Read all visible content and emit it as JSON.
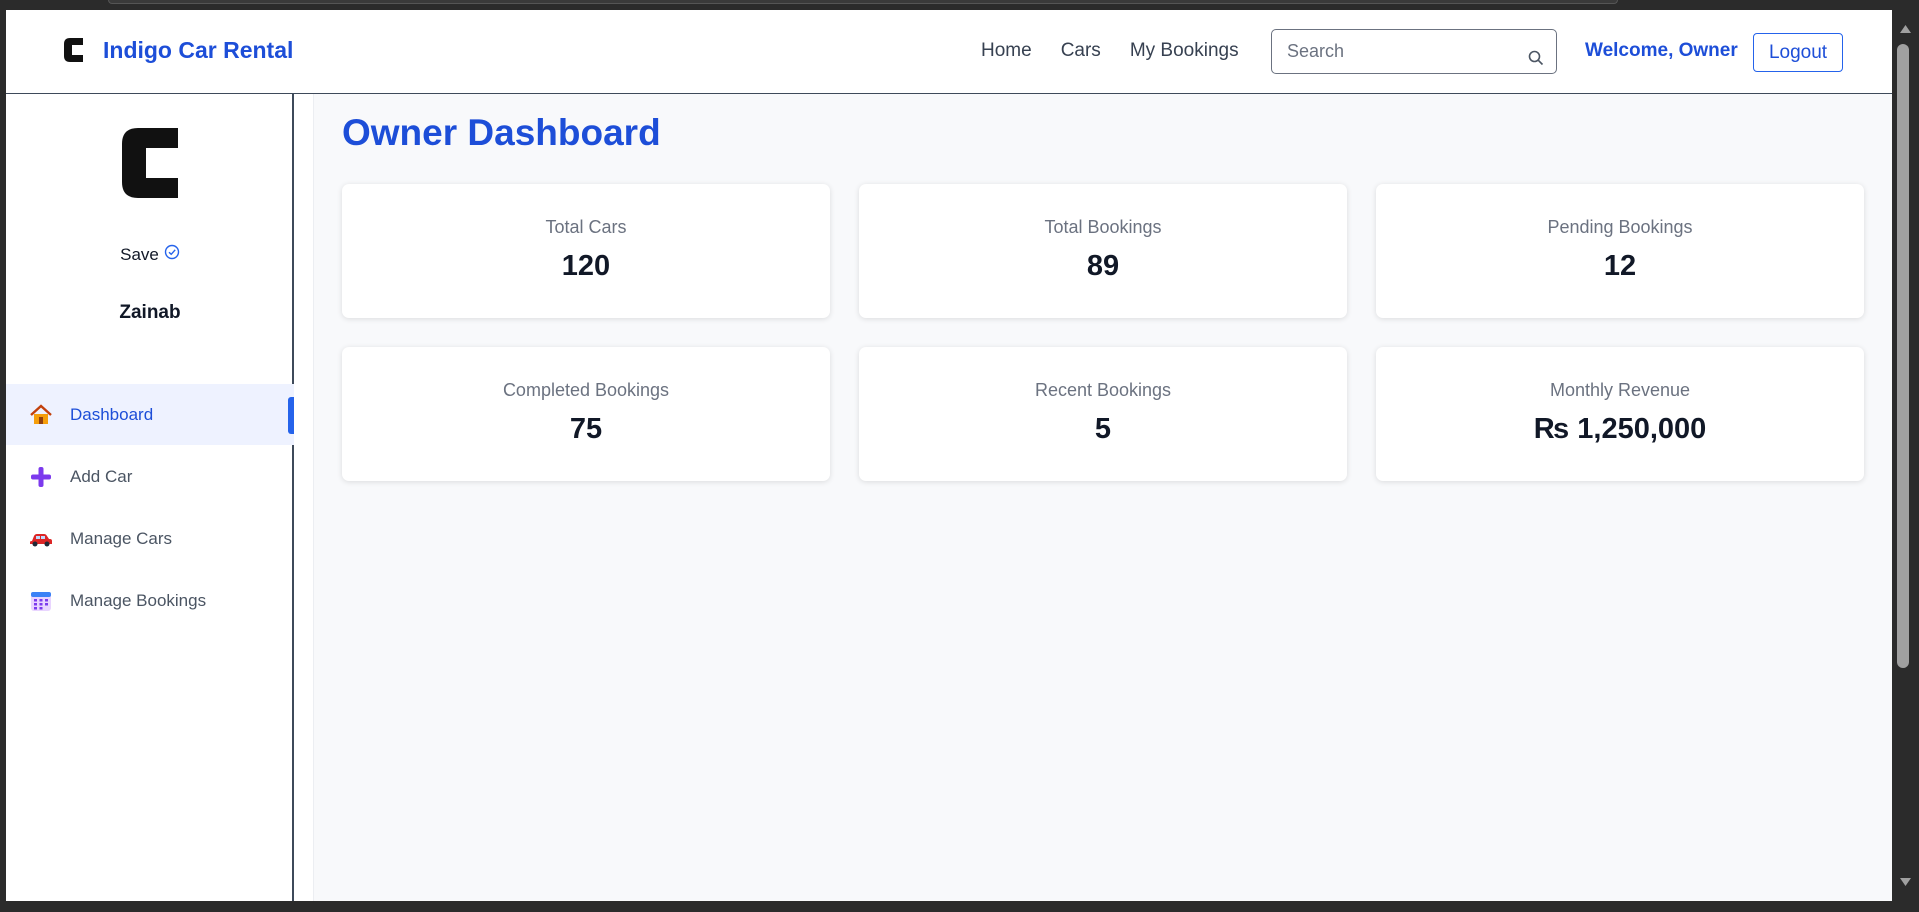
{
  "header": {
    "brand_title": "Indigo Car Rental",
    "nav": [
      "Home",
      "Cars",
      "My Bookings"
    ],
    "search_placeholder": "Search",
    "welcome": "Welcome, Owner",
    "logout_label": "Logout"
  },
  "sidebar": {
    "save_label": "Save",
    "username": "Zainab",
    "items": [
      {
        "label": "Dashboard",
        "icon": "house-icon",
        "active": true
      },
      {
        "label": "Add Car",
        "icon": "plus-icon",
        "active": false
      },
      {
        "label": "Manage Cars",
        "icon": "car-icon",
        "active": false
      },
      {
        "label": "Manage Bookings",
        "icon": "calendar-icon",
        "active": false
      }
    ]
  },
  "main": {
    "title": "Owner Dashboard",
    "stats": [
      {
        "label": "Total Cars",
        "value": "120"
      },
      {
        "label": "Total Bookings",
        "value": "89"
      },
      {
        "label": "Pending Bookings",
        "value": "12"
      },
      {
        "label": "Completed Bookings",
        "value": "75"
      },
      {
        "label": "Recent Bookings",
        "value": "5"
      },
      {
        "label": "Monthly Revenue",
        "value": "₨ 1,250,000"
      }
    ]
  },
  "colors": {
    "accent": "#1d4ed8",
    "active_bg": "#eef2ff",
    "page_bg": "#f8f9fb"
  }
}
